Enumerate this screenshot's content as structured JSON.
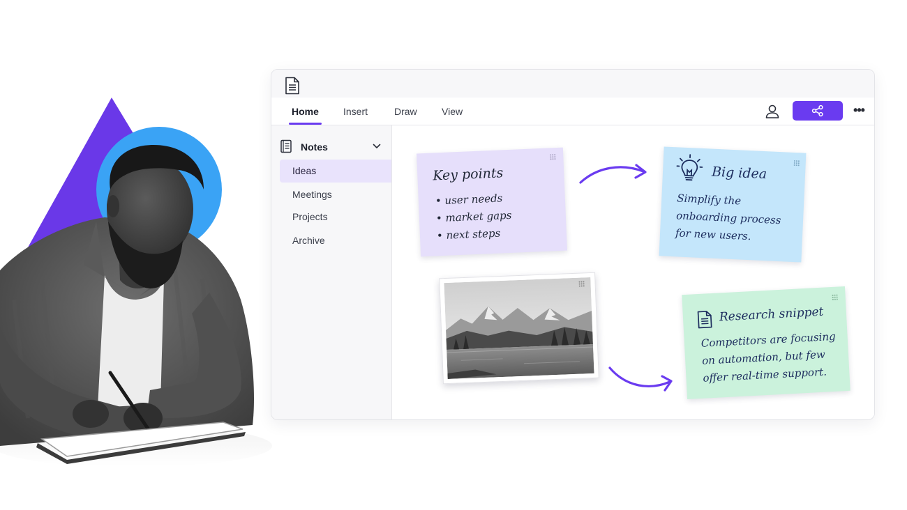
{
  "colors": {
    "accent": "#6a3bf0",
    "selected_bg": "#e9e3fc",
    "key_points_note": "#e6dffb",
    "big_idea_note": "#c4e6fb",
    "research_note": "#cbf2dc",
    "triangle": "#6a38e8",
    "circle": "#3aa3f5"
  },
  "app": {
    "icon": "document-icon"
  },
  "ribbon": {
    "tabs": [
      {
        "label": "Home",
        "active": true
      },
      {
        "label": "Insert",
        "active": false
      },
      {
        "label": "Draw",
        "active": false
      },
      {
        "label": "View",
        "active": false
      }
    ],
    "user_icon": "user-icon",
    "share_icon": "share-icon",
    "more_icon": "more-icon",
    "more_glyph": "•••"
  },
  "sidebar": {
    "notebook_title": "Notes",
    "notebook_icon": "notebook-icon",
    "chevron_icon": "chevron-down-icon",
    "items": [
      {
        "label": "Ideas",
        "selected": true
      },
      {
        "label": "Meetings",
        "selected": false
      },
      {
        "label": "Projects",
        "selected": false
      },
      {
        "label": "Archive",
        "selected": false
      }
    ]
  },
  "canvas": {
    "key_points": {
      "title": "Key points",
      "items": [
        "user needs",
        "market gaps",
        "next steps"
      ]
    },
    "big_idea": {
      "icon": "lightbulb-icon",
      "title": "Big idea",
      "lines": [
        "Simplify the",
        "onboarding process",
        "for new users."
      ]
    },
    "photo": {
      "icon": "mountain-landscape-photo"
    },
    "research": {
      "icon": "document-icon",
      "title": "Research snippet",
      "lines": [
        "Competitors are focusing",
        "on automation, but few",
        "offer real-time support."
      ]
    }
  },
  "hero": {
    "subject": "man-writing-in-notebook-illustration"
  }
}
